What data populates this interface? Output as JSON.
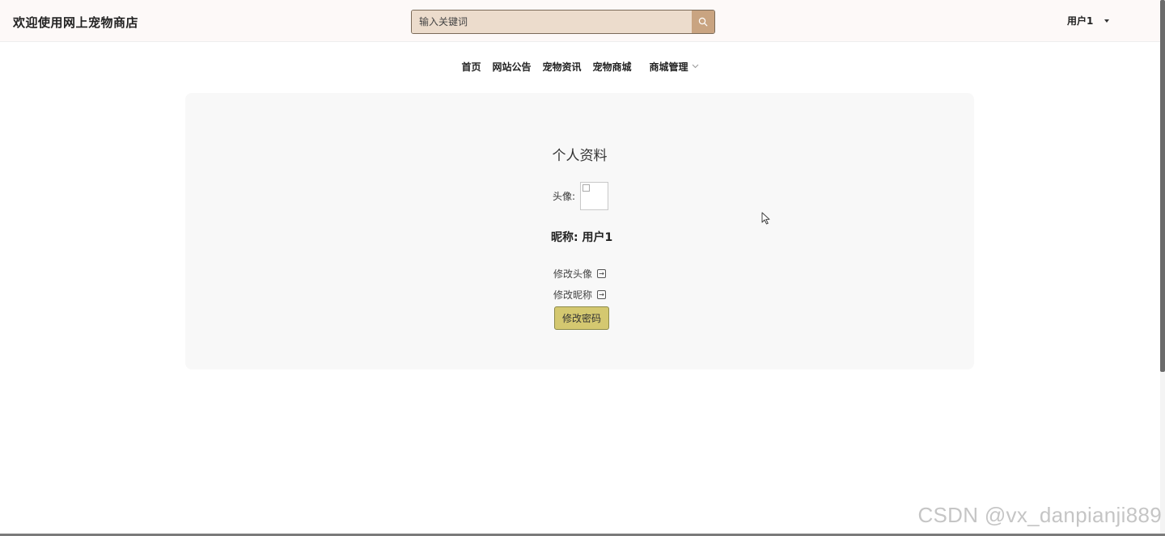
{
  "header": {
    "brand": "欢迎使用网上宠物商店",
    "search": {
      "placeholder": "输入关键词",
      "button_icon": "search-icon"
    },
    "user": {
      "name": "用户1",
      "dropdown_icon": "caret-down-icon"
    }
  },
  "nav": {
    "items": [
      {
        "label": "首页"
      },
      {
        "label": "网站公告"
      },
      {
        "label": "宠物资讯"
      },
      {
        "label": "宠物商城"
      },
      {
        "label": "商城管理",
        "has_dropdown": true
      }
    ]
  },
  "profile": {
    "title": "个人资料",
    "avatar_label": "头像:",
    "nickname_label": "昵称:",
    "nickname_value": "用户1",
    "actions": {
      "change_avatar": "修改头像",
      "change_nickname": "修改昵称",
      "change_password": "修改密码"
    }
  },
  "watermark": "CSDN @vx_danpianji889",
  "colors": {
    "header_bg": "#fdf9f8",
    "search_bg": "#ecdccc",
    "search_button": "#c9a481",
    "card_bg": "#f8f8f8",
    "password_button": "#d4c870"
  }
}
